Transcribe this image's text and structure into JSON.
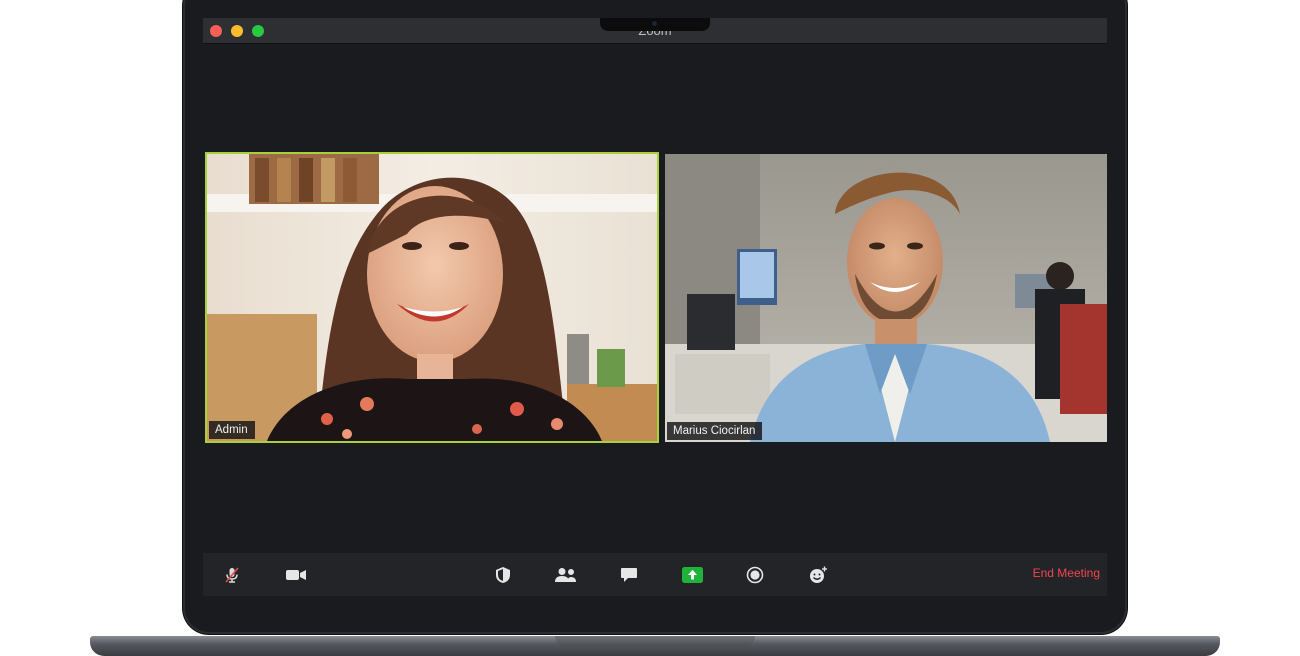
{
  "window": {
    "title": "Zoom"
  },
  "participants": [
    {
      "name": "Admin",
      "active_speaker": true
    },
    {
      "name": "Marius Ciocirlan",
      "active_speaker": false
    }
  ],
  "toolbar": {
    "icons": [
      "mic-muted-icon",
      "video-camera-icon",
      "security-shield-icon",
      "participants-icon",
      "chat-icon",
      "share-screen-icon",
      "record-icon",
      "reactions-icon"
    ],
    "end_meeting_label": "End Meeting"
  },
  "colors": {
    "active_speaker_border": "#a6d13d",
    "share_screen_green": "#1fb33a",
    "end_meeting_red": "#f0454f"
  }
}
